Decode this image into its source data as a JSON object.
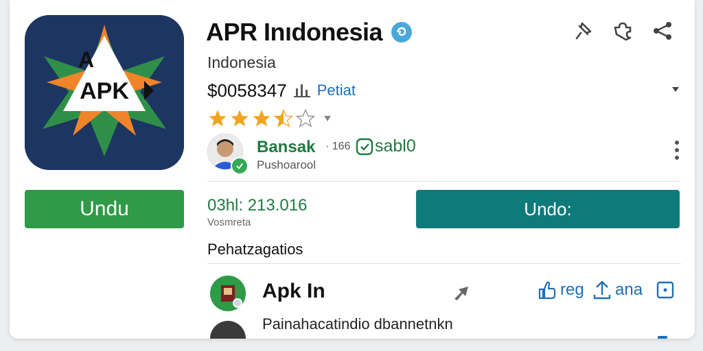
{
  "app": {
    "title": "APR Inıdonesia",
    "subtitle": "Indonesia",
    "icon_text": "APK",
    "icon_letter": "A",
    "price": "$0058347",
    "price_link": "Petiat"
  },
  "rating": {
    "stars": 3.5,
    "max": 5
  },
  "developer": {
    "name": "Bansak",
    "meta": "· 166",
    "tag": "sabl0",
    "role": "Pushoarool"
  },
  "buttons": {
    "left_install": "Undu",
    "main_install": "Undo:"
  },
  "stats": {
    "value": "03hl: 213.016",
    "label": "Vosmreta"
  },
  "section": {
    "heading": "Pehatzagatios"
  },
  "list": {
    "item1": {
      "title": "Apk In",
      "action1": "reg",
      "action2": "ana"
    },
    "item2": {
      "text": "Painahacatindio dbannetnkn"
    }
  },
  "colors": {
    "green": "#2f9a47",
    "teal": "#0f7a7a",
    "blue": "#1d6fb8",
    "star": "#f2a41f",
    "icon_bg": "#1d3561",
    "icon_orange": "#f0842a",
    "icon_green": "#2f8f48"
  },
  "icons": {
    "verified": "verified-badge-icon",
    "top_actions": [
      "pin-icon",
      "puzzle-icon",
      "share-icon"
    ],
    "more": "more-vert-icon"
  }
}
